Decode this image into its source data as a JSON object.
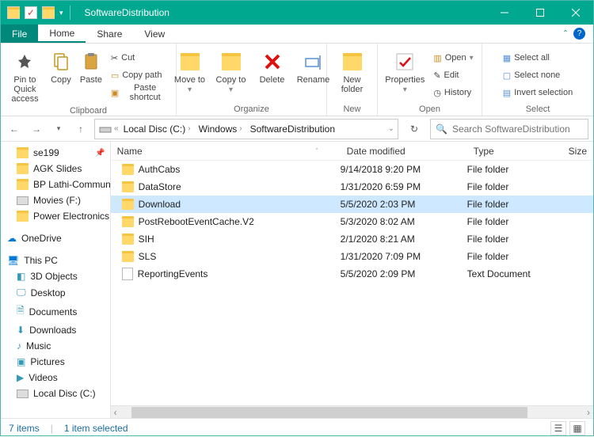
{
  "window": {
    "title": "SoftwareDistribution"
  },
  "menutabs": {
    "file": "File",
    "home": "Home",
    "share": "Share",
    "view": "View"
  },
  "ribbon": {
    "clipboard": {
      "pin": "Pin to Quick access",
      "copy": "Copy",
      "paste": "Paste",
      "cut": "Cut",
      "copypath": "Copy path",
      "shortcut": "Paste shortcut",
      "label": "Clipboard"
    },
    "organize": {
      "moveto": "Move to",
      "copyto": "Copy to",
      "delete": "Delete",
      "rename": "Rename",
      "label": "Organize"
    },
    "new": {
      "newfolder": "New folder",
      "label": "New"
    },
    "open": {
      "properties": "Properties",
      "open": "Open",
      "edit": "Edit",
      "history": "History",
      "label": "Open"
    },
    "select": {
      "all": "Select all",
      "none": "Select none",
      "invert": "Invert selection",
      "label": "Select"
    }
  },
  "breadcrumb": {
    "seg1": "Local Disc (C:)",
    "seg2": "Windows",
    "seg3": "SoftwareDistribution"
  },
  "search": {
    "placeholder": "Search SoftwareDistribution"
  },
  "columns": {
    "name": "Name",
    "date": "Date modified",
    "type": "Type",
    "size": "Size"
  },
  "navitems": {
    "i0": "se199",
    "i1": "AGK Slides",
    "i2": "BP Lathi-Communi",
    "i3": "Movies (F:)",
    "i4": "Power Electronics",
    "onedrive": "OneDrive",
    "thispc": "This PC",
    "p0": "3D Objects",
    "p1": "Desktop",
    "p2": "Documents",
    "p3": "Downloads",
    "p4": "Music",
    "p5": "Pictures",
    "p6": "Videos",
    "p7": "Local Disc (C:)"
  },
  "rows": [
    {
      "name": "AuthCabs",
      "date": "9/14/2018 9:20 PM",
      "type": "File folder",
      "icon": "folder"
    },
    {
      "name": "DataStore",
      "date": "1/31/2020 6:59 PM",
      "type": "File folder",
      "icon": "folder"
    },
    {
      "name": "Download",
      "date": "5/5/2020 2:03 PM",
      "type": "File folder",
      "icon": "folder",
      "selected": true
    },
    {
      "name": "PostRebootEventCache.V2",
      "date": "5/3/2020 8:02 AM",
      "type": "File folder",
      "icon": "folder"
    },
    {
      "name": "SIH",
      "date": "2/1/2020 8:21 AM",
      "type": "File folder",
      "icon": "folder"
    },
    {
      "name": "SLS",
      "date": "1/31/2020 7:09 PM",
      "type": "File folder",
      "icon": "folder"
    },
    {
      "name": "ReportingEvents",
      "date": "5/5/2020 2:09 PM",
      "type": "Text Document",
      "icon": "file"
    }
  ],
  "status": {
    "count": "7 items",
    "selected": "1 item selected"
  }
}
